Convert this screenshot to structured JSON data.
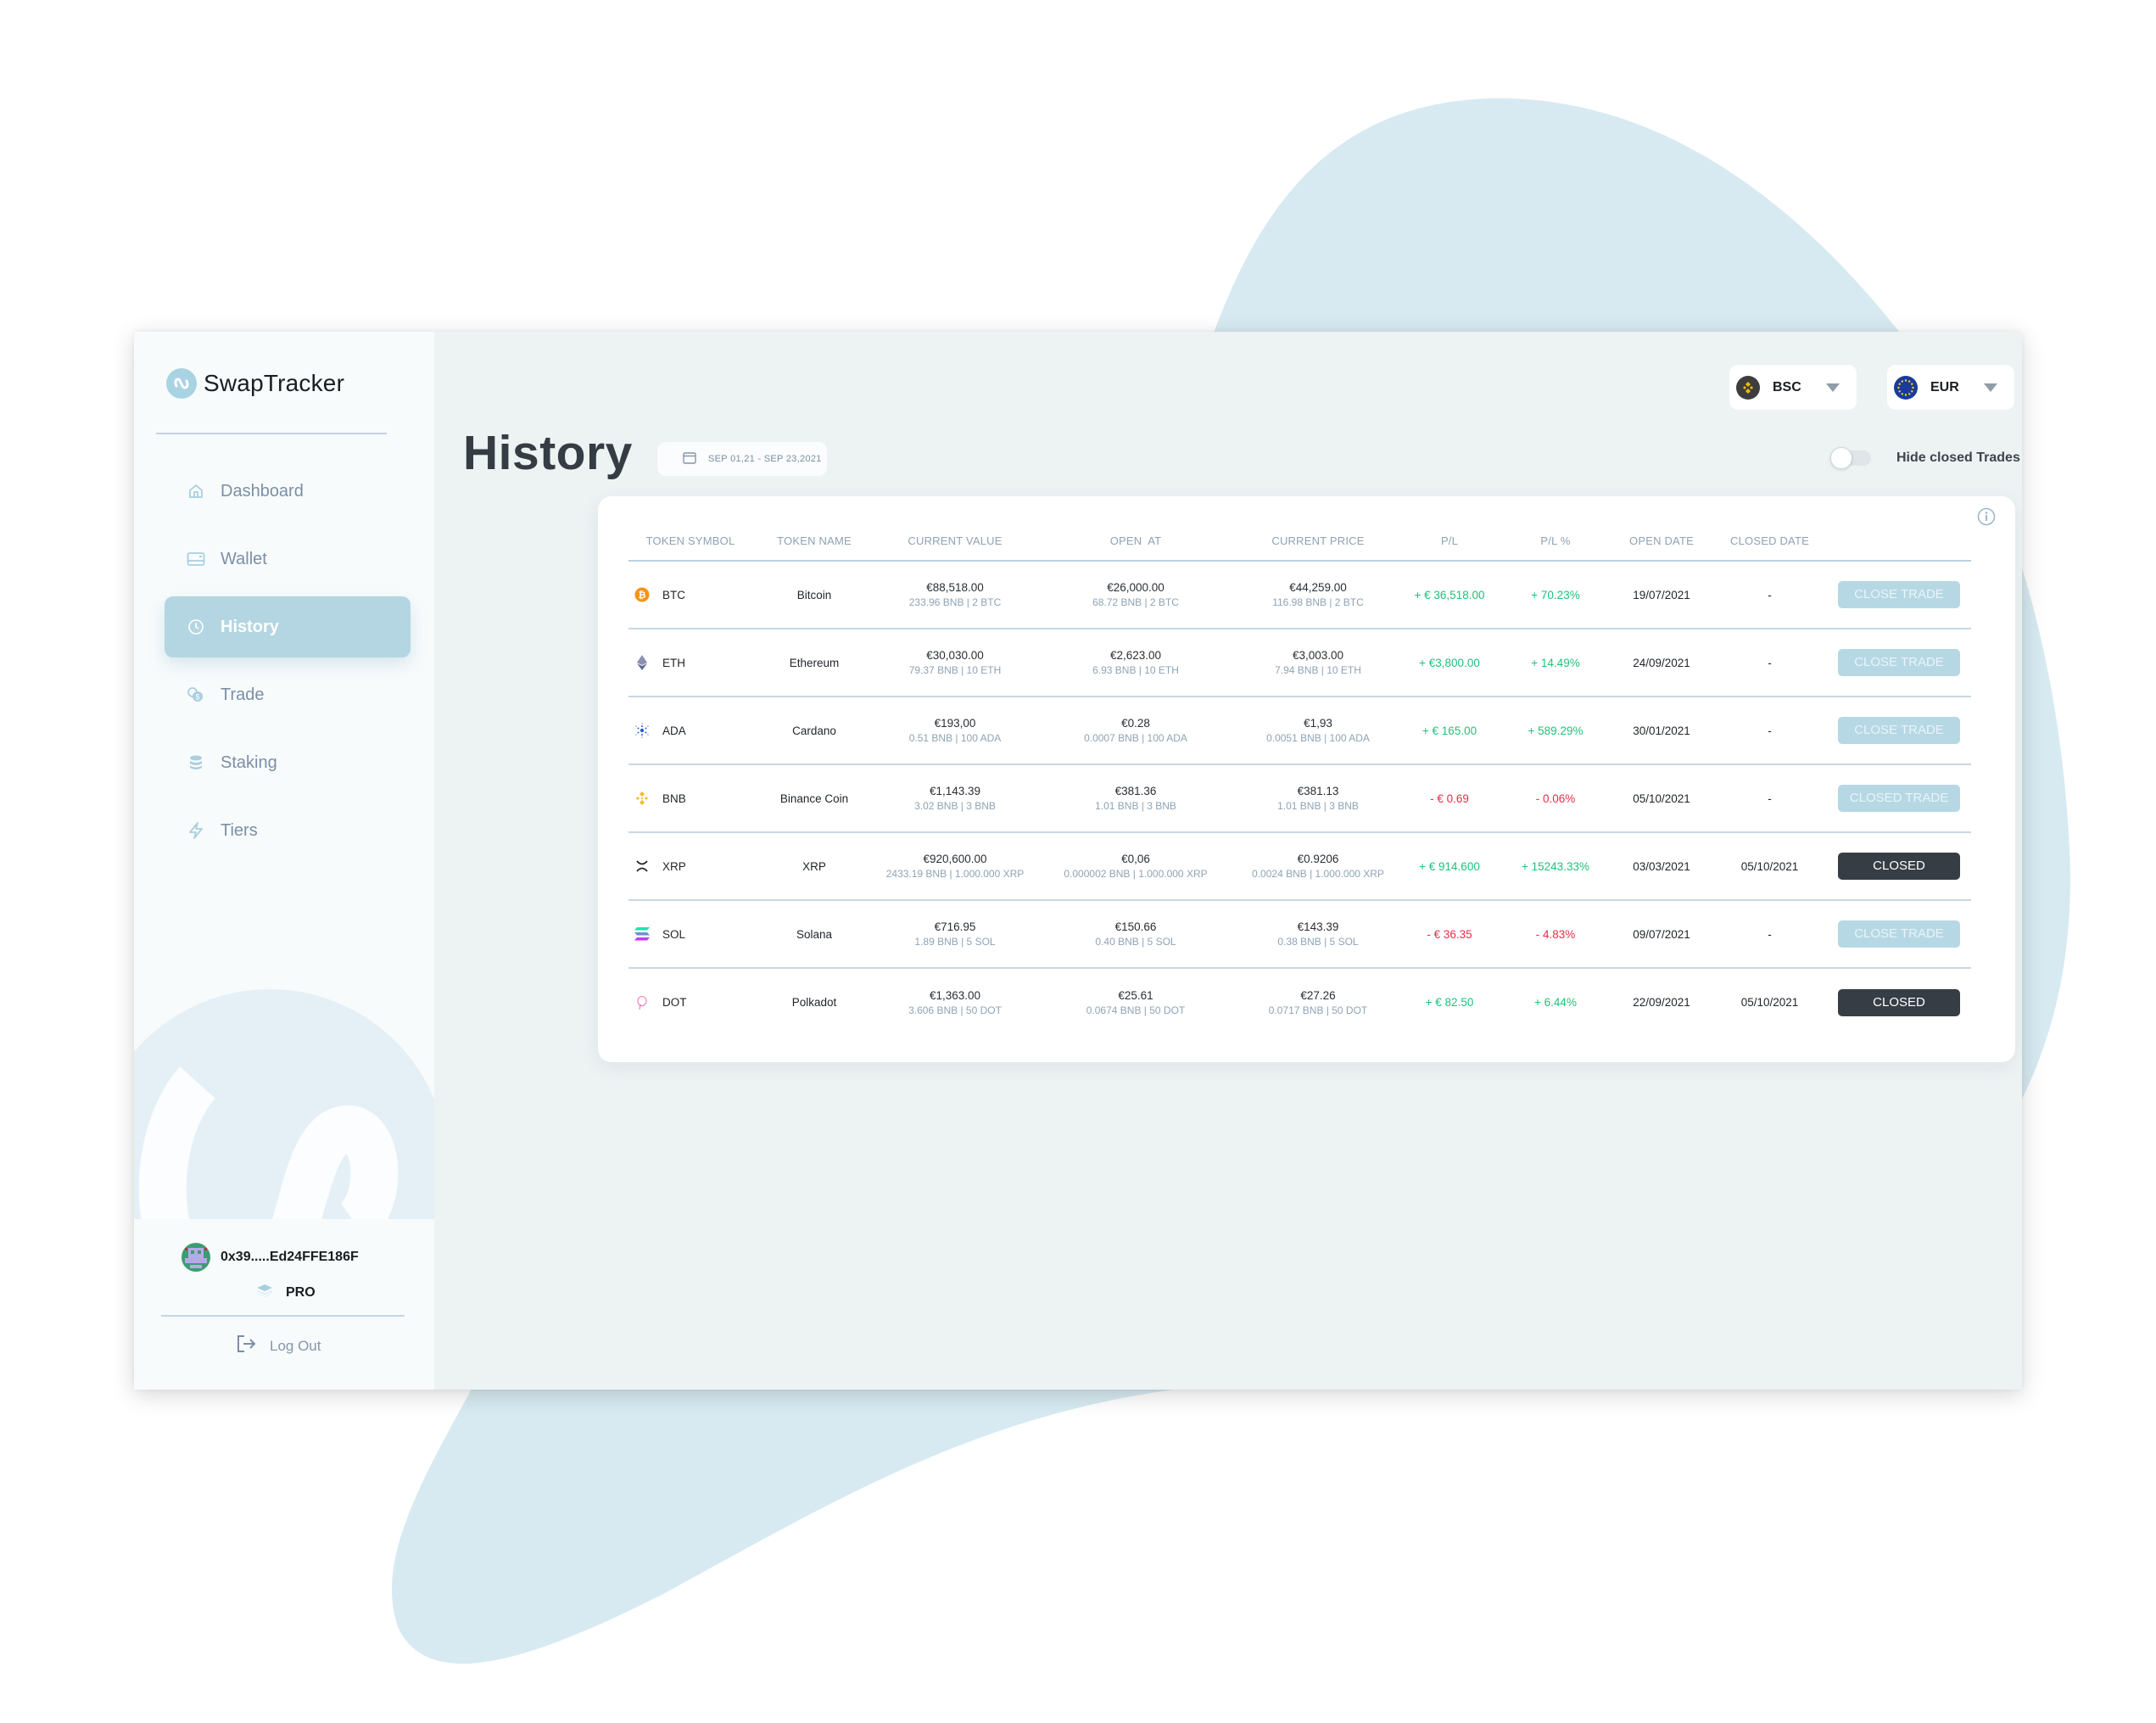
{
  "app": {
    "name": "SwapTracker"
  },
  "sidebar": {
    "items": [
      {
        "id": "dashboard",
        "label": "Dashboard",
        "icon": "home-icon",
        "active": false
      },
      {
        "id": "wallet",
        "label": "Wallet",
        "icon": "wallet-icon",
        "active": false
      },
      {
        "id": "history",
        "label": "History",
        "icon": "clock-icon",
        "active": true
      },
      {
        "id": "trade",
        "label": "Trade",
        "icon": "coins-icon",
        "active": false
      },
      {
        "id": "staking",
        "label": "Staking",
        "icon": "database-icon",
        "active": false
      },
      {
        "id": "tiers",
        "label": "Tiers",
        "icon": "lightning-icon",
        "active": false
      }
    ],
    "user": {
      "address": "0x39.....Ed24FFE186F",
      "tier": "PRO"
    },
    "logout_label": "Log Out"
  },
  "header": {
    "title": "History",
    "date_range": "SEP 01,21 - SEP 23,2021",
    "network": {
      "label": "BSC",
      "icon": "binance-icon"
    },
    "currency": {
      "label": "EUR",
      "icon": "eu-flag-icon"
    },
    "hide_closed_label": "Hide closed Trades",
    "hide_closed_on": false
  },
  "table": {
    "columns": [
      "TOKEN SYMBOL",
      "TOKEN NAME",
      "CURRENT VALUE",
      "OPEN  AT",
      "CURRENT PRICE",
      "P/L",
      "P/L %",
      "OPEN DATE",
      "CLOSED DATE",
      ""
    ],
    "rows": [
      {
        "symbol": "BTC",
        "icon": "bitcoin-icon",
        "name": "Bitcoin",
        "current_value": "€88,518.00",
        "current_value_sub": "233.96 BNB | 2 BTC",
        "open_at": "€26,000.00",
        "open_at_sub": "68.72 BNB | 2 BTC",
        "current_price": "€44,259.00",
        "current_price_sub": "116.98 BNB | 2 BTC",
        "pl": "+ € 36,518.00",
        "pl_pct": "+ 70.23%",
        "trend": "pos",
        "open_date": "19/07/2021",
        "closed_date": "-",
        "action": "CLOSE TRADE",
        "action_style": "open"
      },
      {
        "symbol": "ETH",
        "icon": "ethereum-icon",
        "name": "Ethereum",
        "current_value": "€30,030.00",
        "current_value_sub": "79.37 BNB | 10 ETH",
        "open_at": "€2,623.00",
        "open_at_sub": "6.93 BNB | 10 ETH",
        "current_price": "€3,003.00",
        "current_price_sub": "7.94 BNB | 10 ETH",
        "pl": "+ €3,800.00",
        "pl_pct": "+ 14.49%",
        "trend": "pos",
        "open_date": "24/09/2021",
        "closed_date": "-",
        "action": "CLOSE TRADE",
        "action_style": "open"
      },
      {
        "symbol": "ADA",
        "icon": "cardano-icon",
        "name": "Cardano",
        "current_value": "€193,00",
        "current_value_sub": "0.51 BNB | 100 ADA",
        "open_at": "€0.28",
        "open_at_sub": "0.0007 BNB | 100 ADA",
        "current_price": "€1,93",
        "current_price_sub": "0.0051 BNB | 100 ADA",
        "pl": "+ € 165.00",
        "pl_pct": "+ 589.29%",
        "trend": "pos",
        "open_date": "30/01/2021",
        "closed_date": "-",
        "action": "CLOSE TRADE",
        "action_style": "open"
      },
      {
        "symbol": "BNB",
        "icon": "binance-coin-icon",
        "name": "Binance Coin",
        "current_value": "€1,143.39",
        "current_value_sub": "3.02 BNB | 3 BNB",
        "open_at": "€381.36",
        "open_at_sub": "1.01 BNB | 3 BNB",
        "current_price": "€381.13",
        "current_price_sub": "1.01 BNB | 3 BNB",
        "pl": "- € 0.69",
        "pl_pct": "- 0.06%",
        "trend": "neg",
        "open_date": "05/10/2021",
        "closed_date": "-",
        "action": "CLOSED TRADE",
        "action_style": "open"
      },
      {
        "symbol": "XRP",
        "icon": "xrp-icon",
        "name": "XRP",
        "current_value": "€920,600.00",
        "current_value_sub": "2433.19 BNB | 1.000.000 XRP",
        "open_at": "€0,06",
        "open_at_sub": "0.000002 BNB | 1.000.000 XRP",
        "current_price": "€0.9206",
        "current_price_sub": "0.0024 BNB | 1.000.000 XRP",
        "pl": "+ € 914.600",
        "pl_pct": "+ 15243.33%",
        "trend": "pos",
        "open_date": "03/03/2021",
        "closed_date": "05/10/2021",
        "action": "CLOSED",
        "action_style": "closed"
      },
      {
        "symbol": "SOL",
        "icon": "solana-icon",
        "name": "Solana",
        "current_value": "€716.95",
        "current_value_sub": "1.89 BNB | 5 SOL",
        "open_at": "€150.66",
        "open_at_sub": "0.40 BNB | 5 SOL",
        "current_price": "€143.39",
        "current_price_sub": "0.38 BNB | 5 SOL",
        "pl": "- € 36.35",
        "pl_pct": "- 4.83%",
        "trend": "neg",
        "open_date": "09/07/2021",
        "closed_date": "-",
        "action": "CLOSE TRADE",
        "action_style": "open"
      },
      {
        "symbol": "DOT",
        "icon": "polkadot-icon",
        "name": "Polkadot",
        "current_value": "€1,363.00",
        "current_value_sub": "3.606 BNB | 50 DOT",
        "open_at": "€25.61",
        "open_at_sub": "0.0674 BNB | 50 DOT",
        "current_price": "€27.26",
        "current_price_sub": "0.0717 BNB | 50 DOT",
        "pl": "+ € 82.50",
        "pl_pct": "+ 6.44%",
        "trend": "pos",
        "open_date": "22/09/2021",
        "closed_date": "05/10/2021",
        "action": "CLOSED",
        "action_style": "closed"
      }
    ]
  },
  "colors": {
    "accent": "#b4d6e2",
    "positive": "#1ec27a",
    "negative": "#ee2b46",
    "closed_button": "#363d45",
    "background_blob": "#d7eaf1"
  }
}
